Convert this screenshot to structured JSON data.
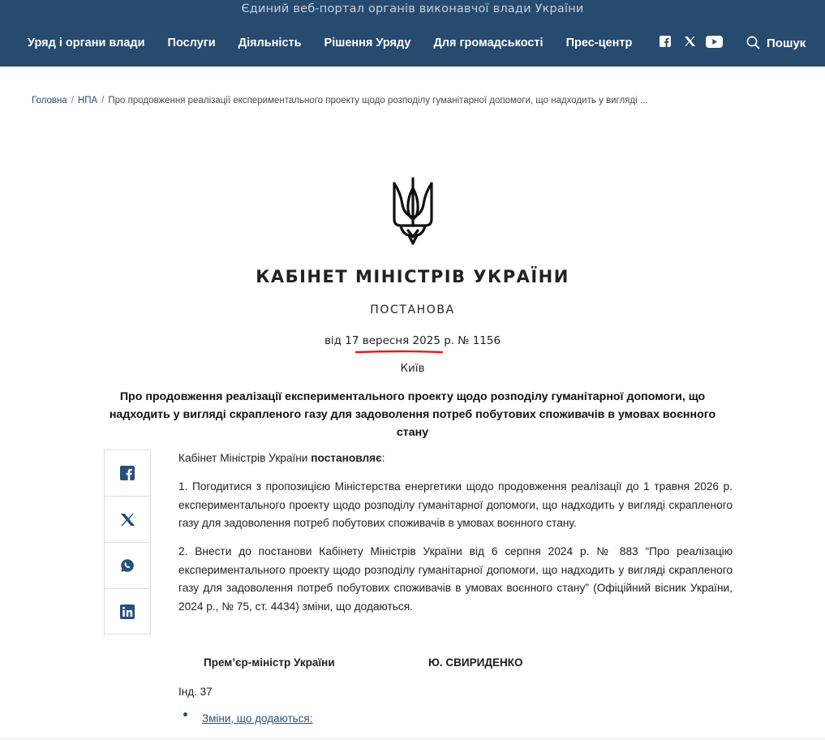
{
  "header": {
    "portal_title": "Єдиний веб-портал органів виконавчої влади України",
    "nav": [
      "Уряд і органи влади",
      "Послуги",
      "Діяльність",
      "Рішення Уряду",
      "Для громадськості",
      "Прес-центр"
    ],
    "social_icons": [
      "facebook-icon",
      "x-icon",
      "youtube-icon"
    ],
    "search_label": "Пошук",
    "colors": {
      "background": "#274a6f",
      "text": "#ffffff"
    }
  },
  "breadcrumb": {
    "home": "Головна",
    "section": "НПА",
    "current": "Про продовження реалізації експериментального проекту щодо розподілу гуманітарної допомоги, що надходить у вигляді ..."
  },
  "document": {
    "authority": "КАБІНЕТ МІНІСТРІВ УКРАЇНИ",
    "kind": "ПОСТАНОВА",
    "date_prefix": "від",
    "date": "17 вересня 2025",
    "date_suffix": "р. №",
    "number": "1156",
    "city": "Київ",
    "title": "Про продовження реалізації експериментального проекту щодо розподілу гуманітарної допомоги, що надходить у вигляді скрапленого газу для задоволення потреб побутових споживачів в умовах воєнного стану",
    "intro_prefix": "Кабінет Міністрів України",
    "intro_bold": "постановляє",
    "intro_suffix": ":",
    "paragraphs": [
      "1. Погодитися з пропозицією Міністерства енергетики щодо продовження реалізації до 1 травня 2026 р. експериментального проекту щодо розподілу гуманітарної допомоги, що надходить у вигляді скрапленого газу для задоволення потреб побутових споживачів в умовах воєнного стану.",
      "2. Внести до постанови Кабінету Міністрів України від 6 серпня 2024 р. №  883 “Про реалізацію експериментального проекту щодо розподілу гуманітарної допомоги, що надходить у вигляді скрапленого газу для задоволення потреб побутових споживачів в умовах воєнного стану” (Офіційний вісник України, 2024 р., № 75, ст. 4434) зміни, що додаються."
    ],
    "signature_role": "Прем’єр-міністр України",
    "signature_name": "Ю. СВИРИДЕНКО",
    "index": "Інд. 37",
    "changes_link": "Зміни, що додаються:"
  },
  "share": [
    "facebook-icon",
    "x-icon",
    "whatsapp-icon",
    "linkedin-icon"
  ],
  "annotation": {
    "underline_color": "#e11d1d"
  }
}
